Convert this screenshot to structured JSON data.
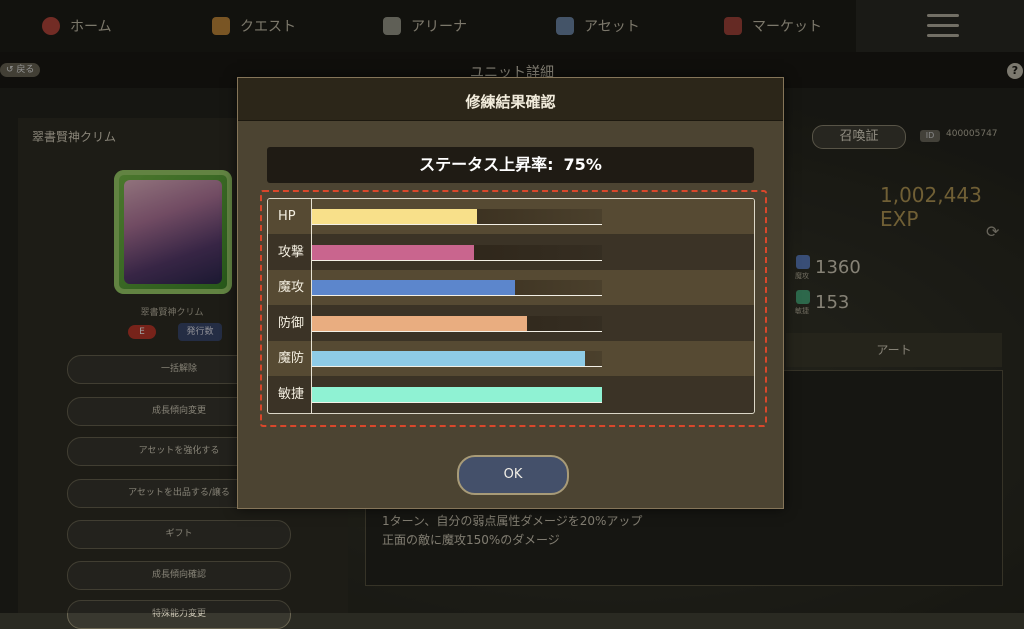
{
  "nav": {
    "items": [
      {
        "label": "ホーム",
        "icon": "home-icon",
        "color": "#b8473c"
      },
      {
        "label": "クエスト",
        "icon": "quest-icon",
        "color": "#c48a3a"
      },
      {
        "label": "アリーナ",
        "icon": "arena-icon",
        "color": "#9a9a8c"
      },
      {
        "label": "アセット",
        "icon": "asset-icon",
        "color": "#6f88a8"
      },
      {
        "label": "マーケット",
        "icon": "market-icon",
        "color": "#a3443b"
      }
    ],
    "menu_icon": "hamburger-icon"
  },
  "subheader": {
    "back_label": "戻る",
    "title": "ユニット詳細",
    "help_label": "?"
  },
  "unit": {
    "name": "翠書賢神クリム",
    "caption": "翠書賢神クリム",
    "rarity": "E",
    "issue_label": "発行数",
    "summon_label": "召喚証",
    "id_label": "ID",
    "id_value": "400005747",
    "exp": "1,002,443 EXP",
    "stats": [
      {
        "label": "魔攻",
        "value": "1360"
      },
      {
        "label": "敏捷",
        "value": "153"
      }
    ],
    "side_buttons": [
      "一括解除",
      "成長傾向変更",
      "アセットを強化する",
      "アセットを出品する/譲る",
      "ギフト",
      "成長傾向確認",
      "特殊能力変更"
    ],
    "art_tab": "アート",
    "skill_lines": [
      "1ターン、自分の弱点属性ダメージを20%アップ",
      "正面の敵に魔攻150%のダメージ"
    ]
  },
  "modal": {
    "title": "修練結果確認",
    "rate_label": "ステータス上昇率:",
    "rate_value": "75%",
    "ok_label": "OK",
    "stats": [
      {
        "label": "HP",
        "fill": 0.57,
        "color": "#f8e08a"
      },
      {
        "label": "攻撃",
        "fill": 0.56,
        "color": "#c9658e"
      },
      {
        "label": "魔攻",
        "fill": 0.7,
        "color": "#5c86cc"
      },
      {
        "label": "防御",
        "fill": 0.74,
        "color": "#e9ad80"
      },
      {
        "label": "魔防",
        "fill": 0.94,
        "color": "#8ecbe6"
      },
      {
        "label": "敏捷",
        "fill": 1.0,
        "color": "#8ff2d3"
      }
    ]
  }
}
